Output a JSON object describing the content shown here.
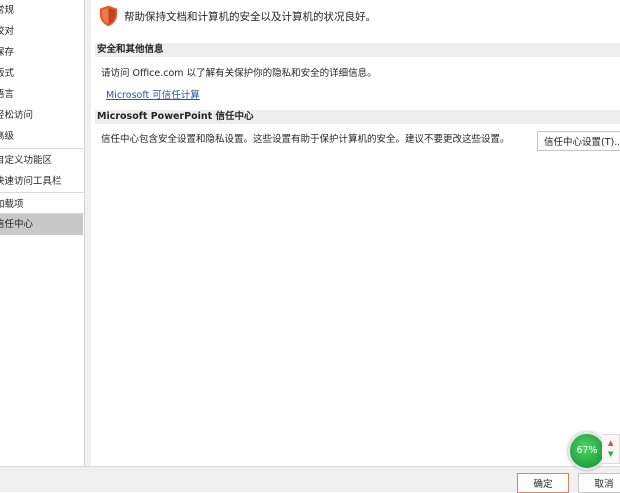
{
  "sidebar": {
    "items": [
      {
        "label": "常规"
      },
      {
        "label": "校对"
      },
      {
        "label": "保存"
      },
      {
        "label": "版式"
      },
      {
        "label": "语言"
      },
      {
        "label": "轻松访问"
      },
      {
        "label": "高级"
      },
      {
        "label": "自定义功能区"
      },
      {
        "label": "快速访问工具栏"
      },
      {
        "label": "加载项"
      },
      {
        "label": "信任中心"
      }
    ],
    "selected_index": 10
  },
  "main": {
    "header_text": "帮助保持文档和计算机的安全以及计算机的状况良好。",
    "section_security": {
      "title": "安全和其他信息",
      "description": "请访问 Office.com  以了解有关保护你的隐私和安全的详细信息。",
      "link": "Microsoft 可信任计算"
    },
    "section_trust_center": {
      "title": "Microsoft PowerPoint 信任中心",
      "description": "信任中心包含安全设置和隐私设置。这些设置有助于保护计算机的安全。建议不要更改这些设置。",
      "button_label": "信任中心设置(T)..."
    }
  },
  "footer": {
    "ok_label": "确定",
    "cancel_label": "取消"
  },
  "perf_widget": {
    "percent_text": "67%",
    "up_icon": "red-up-arrow-icon",
    "down_icon": "green-down-arrow-icon"
  },
  "colors": {
    "shield": "#e8562d",
    "link": "#2b579a",
    "selected_bg": "#c8c8c8",
    "section_bg": "#eeeeee",
    "ok_border": "#d9816d",
    "perf_green": "#27a844"
  }
}
